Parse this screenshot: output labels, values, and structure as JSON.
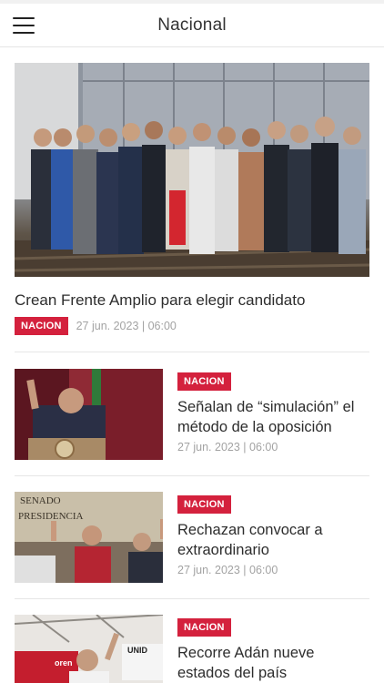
{
  "header": {
    "title": "Nacional"
  },
  "featured": {
    "title": "Crean Frente Amplio para elegir candidato",
    "category": "NACION",
    "date": "27 jun. 2023 | 06:00"
  },
  "articles": [
    {
      "title": "Señalan de “simulación” el método de la oposición",
      "category": "NACION",
      "date": "27 jun. 2023 | 06:00"
    },
    {
      "title": "Rechazan convocar a extraordinario",
      "category": "NACION",
      "date": "27 jun. 2023 | 06:00",
      "image_text": [
        "SENADO",
        "PRESIDENCIA"
      ]
    },
    {
      "title": "Recorre Adán nueve estados del país",
      "category": "NACION",
      "image_text": [
        "UNID",
        "oren"
      ]
    }
  ]
}
